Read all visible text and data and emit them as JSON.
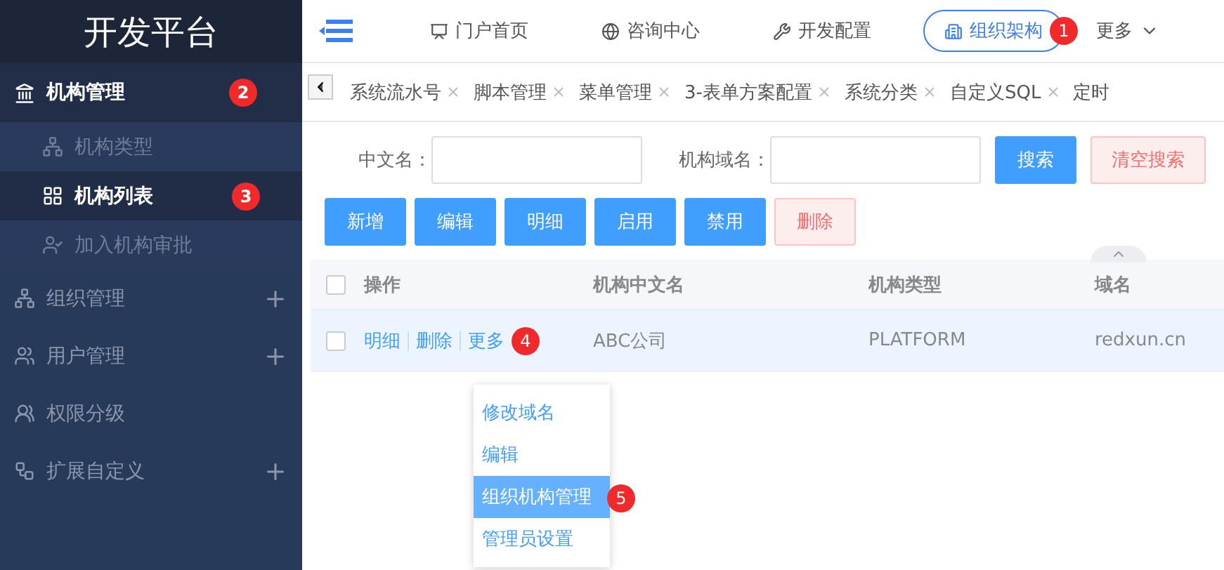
{
  "sidebar": {
    "title": "开发平台",
    "items": [
      {
        "label": "机构管理",
        "expanded": true,
        "collapsed": false,
        "badge": "2",
        "children": [
          {
            "label": "机构类型",
            "selected": false
          },
          {
            "label": "机构列表",
            "selected": true,
            "badge": "3"
          },
          {
            "label": "加入机构审批",
            "selected": false
          }
        ]
      },
      {
        "label": "组织管理",
        "expanded": false,
        "collapsed": true
      },
      {
        "label": "用户管理",
        "expanded": false,
        "collapsed": true
      },
      {
        "label": "权限分级",
        "expanded": false,
        "collapsed": false
      },
      {
        "label": "扩展自定义",
        "expanded": false,
        "collapsed": true
      }
    ]
  },
  "top_nav": {
    "items": [
      {
        "label": "门户首页",
        "selected": false
      },
      {
        "label": "咨询中心",
        "selected": false
      },
      {
        "label": "开发配置",
        "selected": false
      },
      {
        "label": "组织架构",
        "selected": true,
        "badge": "1"
      }
    ],
    "more": "更多"
  },
  "tabs": [
    {
      "label": "系统流水号",
      "closable": true
    },
    {
      "label": "脚本管理",
      "closable": true
    },
    {
      "label": "菜单管理",
      "closable": true
    },
    {
      "label": "3-表单方案配置",
      "closable": true
    },
    {
      "label": "系统分类",
      "closable": true
    },
    {
      "label": "自定义SQL",
      "closable": true
    },
    {
      "label": "定时",
      "closable": false
    }
  ],
  "search": {
    "fields": [
      {
        "label": "中文名："
      },
      {
        "label": "机构域名："
      }
    ],
    "buttons": [
      {
        "label": "搜索",
        "kind": "primary"
      },
      {
        "label": "清空搜索",
        "kind": "danger"
      }
    ]
  },
  "actions": [
    {
      "label": "新增",
      "kind": "primary"
    },
    {
      "label": "编辑",
      "kind": "primary"
    },
    {
      "label": "明细",
      "kind": "primary"
    },
    {
      "label": "启用",
      "kind": "primary"
    },
    {
      "label": "禁用",
      "kind": "primary"
    },
    {
      "label": "删除",
      "kind": "danger"
    }
  ],
  "table": {
    "header_checked": false,
    "columns": [
      "操作",
      "机构中文名",
      "机构类型",
      "域名"
    ],
    "rows": [
      {
        "checked": false,
        "highlighted": true,
        "operations": [
          "明细",
          "删除",
          "更多"
        ],
        "badge": "4",
        "chinese_name": "ABC公司",
        "org_type": "PLATFORM",
        "domain": "redxun.cn"
      }
    ]
  },
  "dropdown_menu": {
    "items": [
      {
        "label": "修改域名",
        "selected": false
      },
      {
        "label": "编辑",
        "selected": false
      },
      {
        "label": "组织机构管理",
        "selected": true,
        "badge": "5"
      },
      {
        "label": "管理员设置",
        "selected": false
      }
    ]
  }
}
